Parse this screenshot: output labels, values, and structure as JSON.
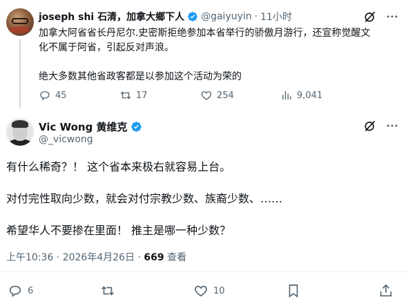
{
  "quoted_post": {
    "author_name": "joseph shi 石清，加拿大鄉下人",
    "handle": "@gaiyuyin",
    "separator": "·",
    "time": "11小时",
    "text_lines": [
      "加拿大阿省省长丹尼尔.史密斯拒绝参加本省举行的骄傲月游行，还宣称觉醒文",
      "化不属于阿省，引起反对声浪。",
      "",
      "绝大多数其他省政客都是以参加这个活动为荣的"
    ],
    "replies": "45",
    "reposts": "17",
    "likes": "254",
    "views": "9,041"
  },
  "main_post": {
    "author_name": "Vic Wong 黄维克",
    "handle": "@_vicwong",
    "text_lines": [
      "有什么稀奇？！ 这个省本来极右就容易上台。",
      "",
      "对付完性取向少数，就会对付宗教少数、族裔少数、……",
      "",
      "希望华人不要掺在里面！ 推主是哪一种少数？"
    ],
    "timestamp": "上午10:36 · 2026年4月26日 ·",
    "view_count": "669",
    "view_label": "查看",
    "replies": "6",
    "likes": "10"
  },
  "colors": {
    "verified": "#1d9bf0",
    "secondary_text": "#536471",
    "primary_text": "#0f1419"
  },
  "icons": [
    "verified-badge-icon",
    "grok-icon",
    "more-icon",
    "reply-icon",
    "repost-icon",
    "like-icon",
    "views-icon",
    "bookmark-icon",
    "share-icon"
  ]
}
